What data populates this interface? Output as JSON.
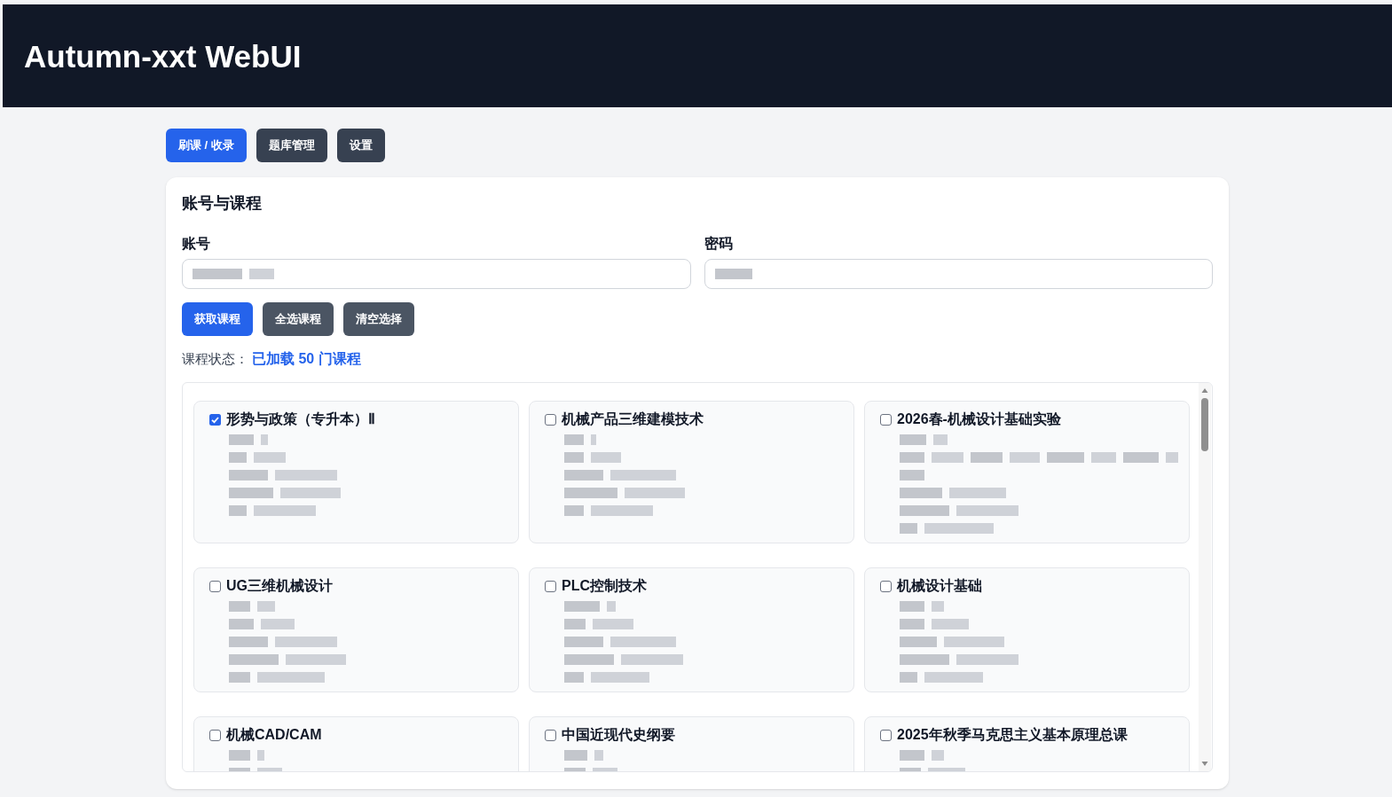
{
  "header": {
    "title": "Autumn-xxt WebUI"
  },
  "tabs": [
    {
      "label": "刷课 / 收录",
      "selected": true
    },
    {
      "label": "题库管理",
      "selected": false
    },
    {
      "label": "设置",
      "selected": false
    }
  ],
  "panel": {
    "title": "账号与课程",
    "fields": [
      {
        "label": "账号"
      },
      {
        "label": "密码"
      }
    ],
    "buttons": [
      {
        "label": "获取课程",
        "kind": "primary"
      },
      {
        "label": "全选课程",
        "kind": "secondary"
      },
      {
        "label": "清空选择",
        "kind": "secondary"
      }
    ],
    "status": {
      "label": "课程状态：",
      "value": "已加载 50 门课程"
    },
    "courses": [
      {
        "name": "形势与政策（专升本）Ⅱ",
        "checked": true
      },
      {
        "name": "机械产品三维建模技术",
        "checked": false
      },
      {
        "name": "2026春-机械设计基础实验",
        "checked": false
      },
      {
        "name": "UG三维机械设计",
        "checked": false
      },
      {
        "name": "PLC控制技术",
        "checked": false
      },
      {
        "name": "机械设计基础",
        "checked": false
      },
      {
        "name": "机械CAD/CAM",
        "checked": false
      },
      {
        "name": "中国近现代史纲要",
        "checked": false
      },
      {
        "name": "2025年秋季马克思主义基本原理总课",
        "checked": false
      }
    ]
  }
}
